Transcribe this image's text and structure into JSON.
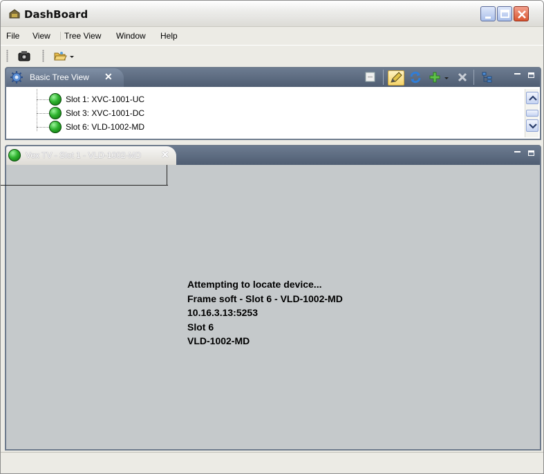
{
  "window": {
    "title": "DashBoard",
    "controls": [
      "minimize",
      "maximize",
      "close"
    ]
  },
  "menubar": {
    "items": [
      "File",
      "View",
      "Tree View",
      "Window",
      "Help"
    ]
  },
  "toolbar": {
    "icons": [
      "camera-icon",
      "open-folder-icon",
      "dropdown-arrow-icon"
    ]
  },
  "tree_view": {
    "tab_label": "Basic Tree View",
    "tab_icon": "gear-icon",
    "toolbar_icons": [
      "collapse-icon",
      "edit-icon",
      "refresh-icon",
      "add-icon",
      "dropdown-arrow-icon",
      "delete-icon",
      "tree-layout-icon",
      "minimize-icon",
      "maximize-icon"
    ],
    "items": [
      {
        "label": "Slot 1: XVC-1001-UC",
        "status": "green"
      },
      {
        "label": "Slot 3: XVC-1001-DC",
        "status": "green"
      },
      {
        "label": "Slot 6: VLD-1002-MD",
        "status": "green"
      }
    ]
  },
  "device_view": {
    "tab_label": "Vox TV - Slot 1 - VLD-1002-MD",
    "status": "green",
    "lines": [
      "Attempting to locate device...",
      "Frame soft - Slot 6 - VLD-1002-MD",
      "10.16.3.13:5253",
      "Slot 6",
      "VLD-1002-MD"
    ]
  },
  "colors": {
    "pane_header": "#5d6b80",
    "content_bg": "#c5c9cb",
    "status_green": "#2fb32f",
    "close_red": "#d9552f"
  }
}
